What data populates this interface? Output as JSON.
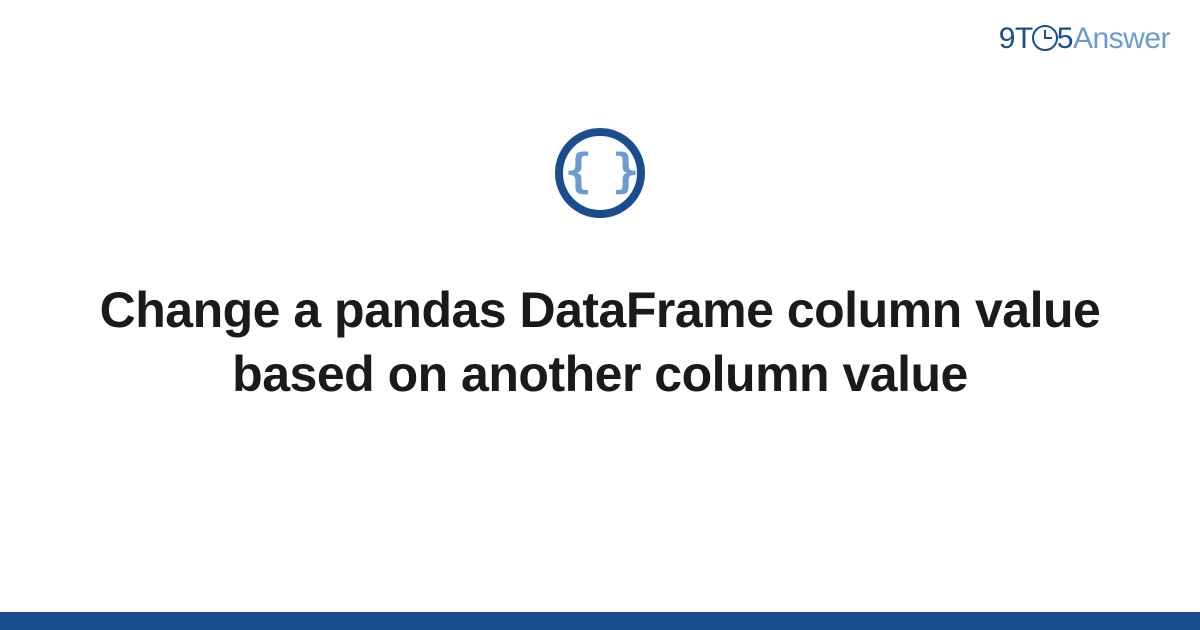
{
  "logo": {
    "part1": "9T",
    "part2": "5",
    "part3": "Answer"
  },
  "icon": {
    "braces": "{ }"
  },
  "title": "Change a pandas DataFrame column value based on another column value"
}
